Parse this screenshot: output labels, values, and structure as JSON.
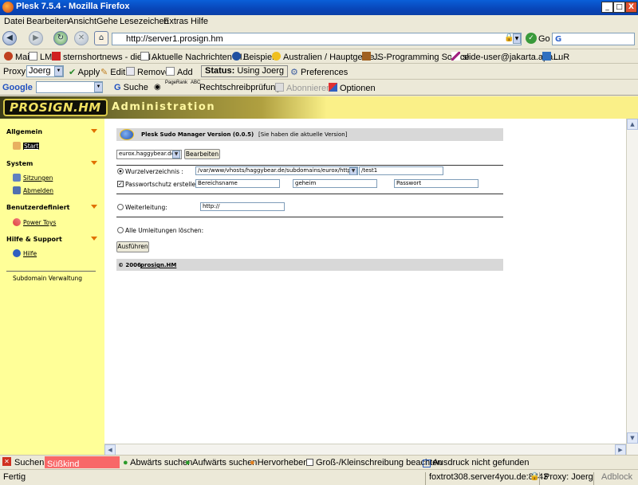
{
  "window": {
    "title": "Plesk 7.5.4 - Mozilla Firefox",
    "min": "_",
    "max": "□",
    "close": "X"
  },
  "menu": [
    "Datei",
    "Bearbeiten",
    "Ansicht",
    "Gehe",
    "Lesezeichen",
    "Extras",
    "Hilfe"
  ],
  "nav": {
    "url": "http://server1.prosign.hm",
    "go_label": "Go",
    "search_value": "G"
  },
  "bookmarks": [
    "Mail",
    "LM",
    "sternshortnews - die N...",
    "Aktuelle Nachrichten - I...",
    "Beispiele",
    "Australien / Hauptgebie...",
    "JS-Programming Source",
    "slide-user@jakarta.apa...",
    "LuR"
  ],
  "proxybar": {
    "label": "Proxy:",
    "value": "Joerg",
    "apply": "Apply",
    "edit": "Edit",
    "remove": "Remove",
    "add": "Add",
    "status_label": "Status:",
    "status_value": "Using Joerg",
    "preferences": "Preferences"
  },
  "googlebar": {
    "google": "Google",
    "search": "Suche",
    "pagerank": "PageRank",
    "abc": "ABC",
    "spell": "Rechtschreibprüfung",
    "subscribe": "Abonnieren",
    "options": "Optionen"
  },
  "banner": {
    "logo": "PROSIGN.HM",
    "title": "Administration"
  },
  "sidebar": {
    "sections": [
      {
        "title": "Allgemein",
        "items": [
          "Start"
        ]
      },
      {
        "title": "System",
        "items": [
          "Sitzungen",
          "Abmelden"
        ]
      },
      {
        "title": "Benutzerdefiniert",
        "items": [
          "Power Toys"
        ]
      },
      {
        "title": "Hilfe & Support",
        "items": [
          "Hilfe"
        ]
      }
    ],
    "footer": "Subdomain Verwaltung"
  },
  "panel": {
    "header_title": "Plesk Sudo Manager Version (0.0.5)",
    "header_note": "[Sie haben die aktuelle Version]",
    "domain_select": "eurox.haggybear.de",
    "edit_button": "Bearbeiten",
    "root_label": "Wurzelverzeichnis :",
    "root_path": "/var/www/vhosts/haggybear.de/subdomains/eurox/httpdocs",
    "root_sub": "/test1",
    "pw_label": "Passwortschutz erstellen :",
    "realm": "Bereichsname",
    "user": "geheim",
    "password": "Passwort",
    "redirect_label": "Weiterleitung:",
    "redirect_value": "http://",
    "clear_label": "Alle Umleitungen löschen:",
    "submit": "Ausführen",
    "footer_copy": "© 2006 ",
    "footer_link": "prosign.HM"
  },
  "findbar": {
    "label": "Suchen:",
    "value": "Süßkind",
    "down": "Abwärts suchen",
    "up": "Aufwärts suchen",
    "highlight": "Hervorheben",
    "case": "Groß-/Kleinschreibung beachten",
    "message": "Ausdruck nicht gefunden"
  },
  "statusbar": {
    "text": "Fertig",
    "host": "foxtrot308.server4you.de:8443",
    "proxy": "Proxy: Joerg",
    "adblock": "Adblock"
  }
}
